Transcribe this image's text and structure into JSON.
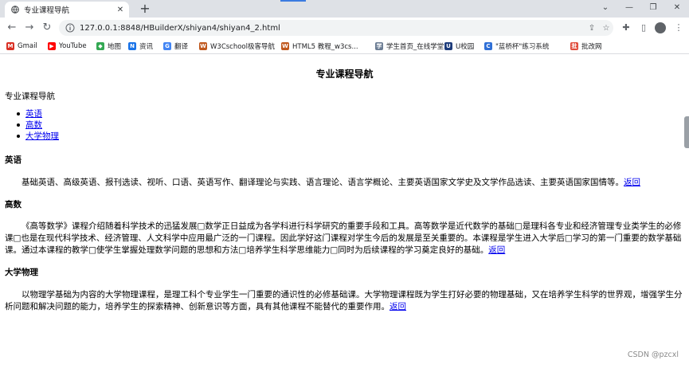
{
  "browser": {
    "tab_title": "专业课程导航",
    "url": "127.0.0.1:8848/HBuilderX/shiyan4/shiyan4_2.html",
    "bookmarks": [
      {
        "label": "Gmail",
        "icon": "gmail-icon",
        "color": "#d93025",
        "glyph": "M"
      },
      {
        "label": "YouTube",
        "icon": "youtube-icon",
        "color": "#ff0000",
        "glyph": "▶"
      },
      {
        "label": "地图",
        "icon": "maps-icon",
        "color": "#34a853",
        "glyph": "◆"
      },
      {
        "label": "资讯",
        "icon": "news-icon",
        "color": "#1a73e8",
        "glyph": "N"
      },
      {
        "label": "翻译",
        "icon": "translate-icon",
        "color": "#4285f4",
        "glyph": "G"
      },
      {
        "label": "W3Cschool极客导航",
        "icon": "w3cschool-icon",
        "color": "#c0581e",
        "glyph": "W"
      },
      {
        "label": "HTML5 教程_w3cs...",
        "icon": "w3cschool-icon",
        "color": "#c0581e",
        "glyph": "W"
      },
      {
        "label": "学生首页_在线学堂...",
        "icon": "xuetang-icon",
        "color": "#6b7c93",
        "glyph": "学"
      },
      {
        "label": "U校园",
        "icon": "uxiaoyuan-icon",
        "color": "#1d3b7a",
        "glyph": "U"
      },
      {
        "label": "\"蓝桥杯\"练习系统",
        "icon": "lanqiao-icon",
        "color": "#2f6fd6",
        "glyph": "C"
      },
      {
        "label": "批改网",
        "icon": "pigai-icon",
        "color": "#e04b3a",
        "glyph": "批"
      }
    ]
  },
  "page": {
    "heading": "专业课程导航",
    "intro": "专业课程导航",
    "toc": [
      "英语",
      "高数",
      "大学物理"
    ],
    "sections": [
      {
        "title": "英语",
        "text": "基础英语、高级英语、报刊选读、视听、口语、英语写作、翻译理论与实践、语言理论、语言学概论、主要英语国家文学史及文学作品选读、主要英语国家国情等。",
        "back": "返回"
      },
      {
        "title": "高数",
        "text": "《高等数学》课程介绍随着科学技术的迅猛发展□数学正日益成为各学科进行科学研究的重要手段和工具。高等数学是近代数学的基础□是理科各专业和经济管理专业类学生的必修课□也是在现代科学技术、经济管理、人文科学中应用最广泛的一门课程。因此学好这门课程对学生今后的发展是至关重要的。本课程是学生进入大学后□学习的第一门重要的数学基础课。通过本课程的教学□使学生掌握处理数学问题的思想和方法□培养学生科学思维能力□同时为后续课程的学习奠定良好的基础。",
        "back": "返回"
      },
      {
        "title": "大学物理",
        "text": "以物理学基础为内容的大学物理课程，是理工科个专业学生一门重要的通识性的必修基础课。大学物理课程既为学生打好必要的物理基础，又在培养学生科学的世界观，增强学生分析问题和解决问题的能力，培养学生的探索精神、创新意识等方面，具有其他课程不能替代的重要作用。",
        "back": "返回"
      }
    ],
    "watermark": "CSDN @pzcxl"
  }
}
